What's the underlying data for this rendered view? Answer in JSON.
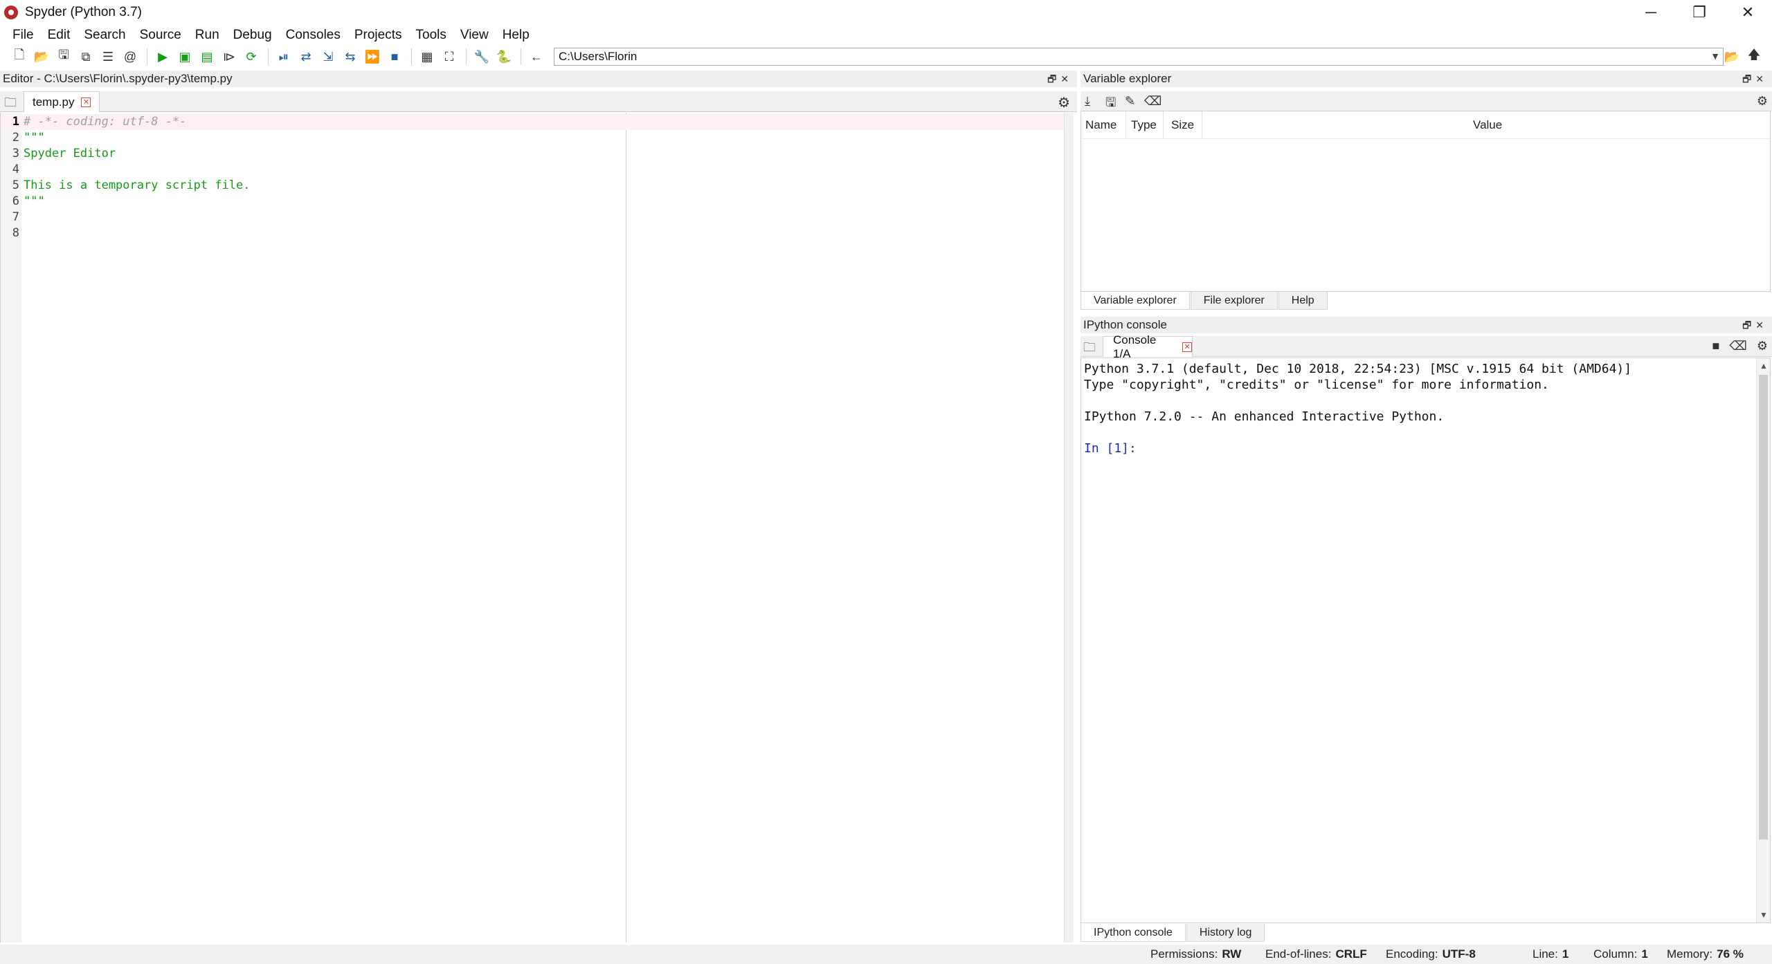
{
  "window": {
    "title": "Spyder (Python 3.7)",
    "minimize": "─",
    "restore": "❐",
    "close": "✕"
  },
  "menu": [
    "File",
    "Edit",
    "Search",
    "Source",
    "Run",
    "Debug",
    "Consoles",
    "Projects",
    "Tools",
    "View",
    "Help"
  ],
  "toolbar": {
    "working_directory": "C:\\Users\\Florin"
  },
  "editor": {
    "pane_title": "Editor - C:\\Users\\Florin\\.spyder-py3\\temp.py",
    "tab_label": "temp.py",
    "current_line": 1,
    "lines": [
      {
        "num": "1",
        "text": "# -*- coding: utf-8 -*-",
        "kind": "comment"
      },
      {
        "num": "2",
        "text": "\"\"\"",
        "kind": "string"
      },
      {
        "num": "3",
        "text": "Spyder Editor",
        "kind": "string"
      },
      {
        "num": "4",
        "text": "",
        "kind": "string"
      },
      {
        "num": "5",
        "text": "This is a temporary script file.",
        "kind": "string"
      },
      {
        "num": "6",
        "text": "\"\"\"",
        "kind": "string"
      },
      {
        "num": "7",
        "text": "",
        "kind": "plain"
      },
      {
        "num": "8",
        "text": "",
        "kind": "plain"
      }
    ]
  },
  "variable_explorer": {
    "pane_title": "Variable explorer",
    "columns": [
      "Name",
      "Type",
      "Size",
      "Value"
    ],
    "tabs": [
      "Variable explorer",
      "File explorer",
      "Help"
    ],
    "active_tab": "Variable explorer"
  },
  "console": {
    "pane_title": "IPython console",
    "tab_label": "Console 1/A",
    "lines": [
      "Python 3.7.1 (default, Dec 10 2018, 22:54:23) [MSC v.1915 64 bit (AMD64)]",
      "Type \"copyright\", \"credits\" or \"license\" for more information.",
      "",
      "IPython 7.2.0 -- An enhanced Interactive Python.",
      "",
      "In [1]:"
    ],
    "tabs": [
      "IPython console",
      "History log"
    ],
    "active_tab": "IPython console"
  },
  "status": {
    "permissions_label": "Permissions:",
    "permissions": "RW",
    "eol_label": "End-of-lines:",
    "eol": "CRLF",
    "encoding_label": "Encoding:",
    "encoding": "UTF-8",
    "line_label": "Line:",
    "line": "1",
    "column_label": "Column:",
    "column": "1",
    "memory_label": "Memory:",
    "memory": "76 %"
  },
  "colors": {
    "run_green": "#159c17",
    "string_green": "#139b16",
    "prompt_blue": "#1a2fa8",
    "close_red": "#d9433a",
    "current_line_bg": "#fcf0f4"
  }
}
